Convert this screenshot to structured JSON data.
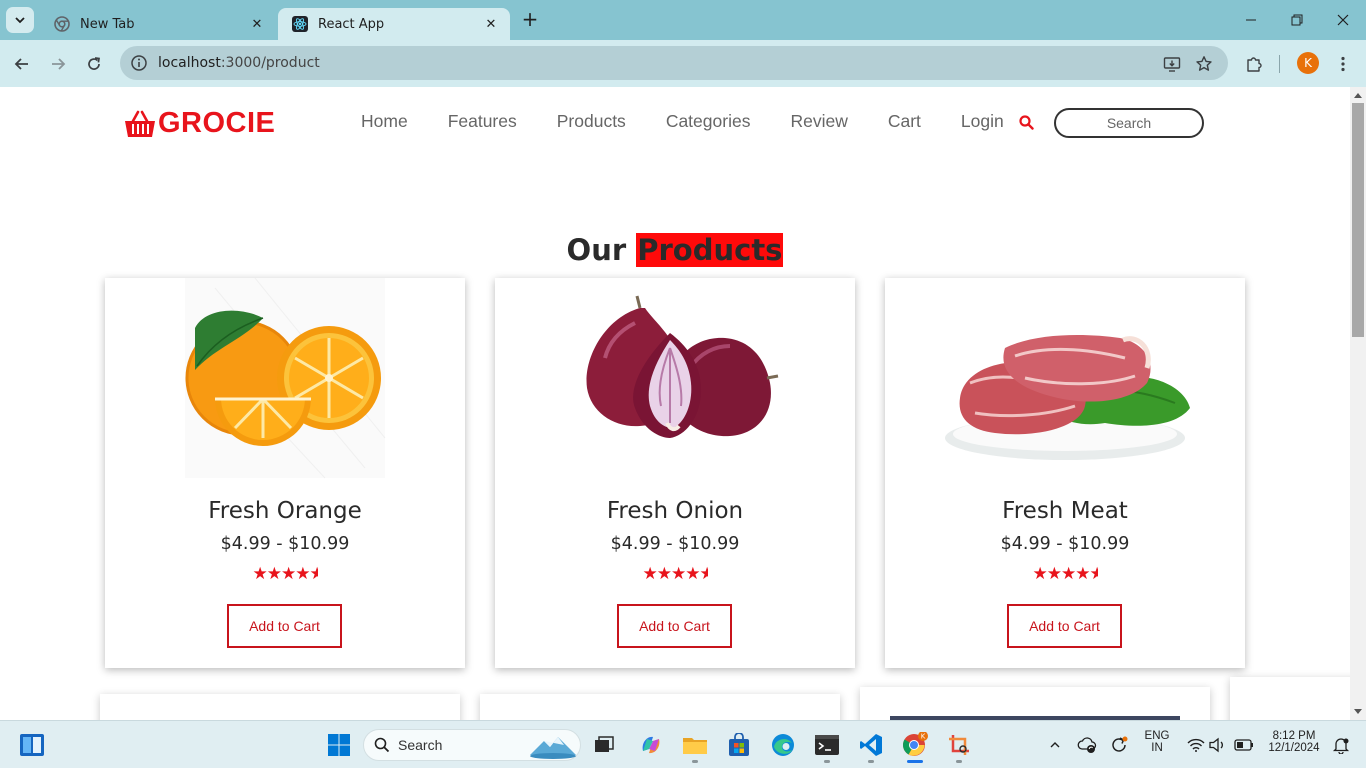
{
  "browser": {
    "tabs": [
      {
        "title": "New Tab",
        "active": false
      },
      {
        "title": "React App",
        "active": true
      }
    ],
    "url_host": "localhost",
    "url_rest": ":3000/product",
    "profile_initial": "K"
  },
  "site": {
    "logo_text": "GROCIE",
    "nav": [
      "Home",
      "Features",
      "Products",
      "Categories",
      "Review",
      "Cart",
      "Login"
    ],
    "search_placeholder": "Search",
    "heading_prefix": "Our ",
    "heading_highlight": "Products",
    "accent_color": "#e8141c",
    "products": [
      {
        "name": "Fresh Orange",
        "price": "$4.99 - $10.99",
        "rating": 4.5,
        "button": "Add to Cart",
        "image_icon": "orange-image"
      },
      {
        "name": "Fresh Onion",
        "price": "$4.99 - $10.99",
        "rating": 4.5,
        "button": "Add to Cart",
        "image_icon": "onion-image"
      },
      {
        "name": "Fresh Meat",
        "price": "$4.99 - $10.99",
        "rating": 4.5,
        "button": "Add to Cart",
        "image_icon": "meat-image"
      }
    ]
  },
  "taskbar": {
    "search_label": "Search",
    "lang_top": "ENG",
    "lang_bottom": "IN",
    "time": "8:12 PM",
    "date": "12/1/2024"
  }
}
